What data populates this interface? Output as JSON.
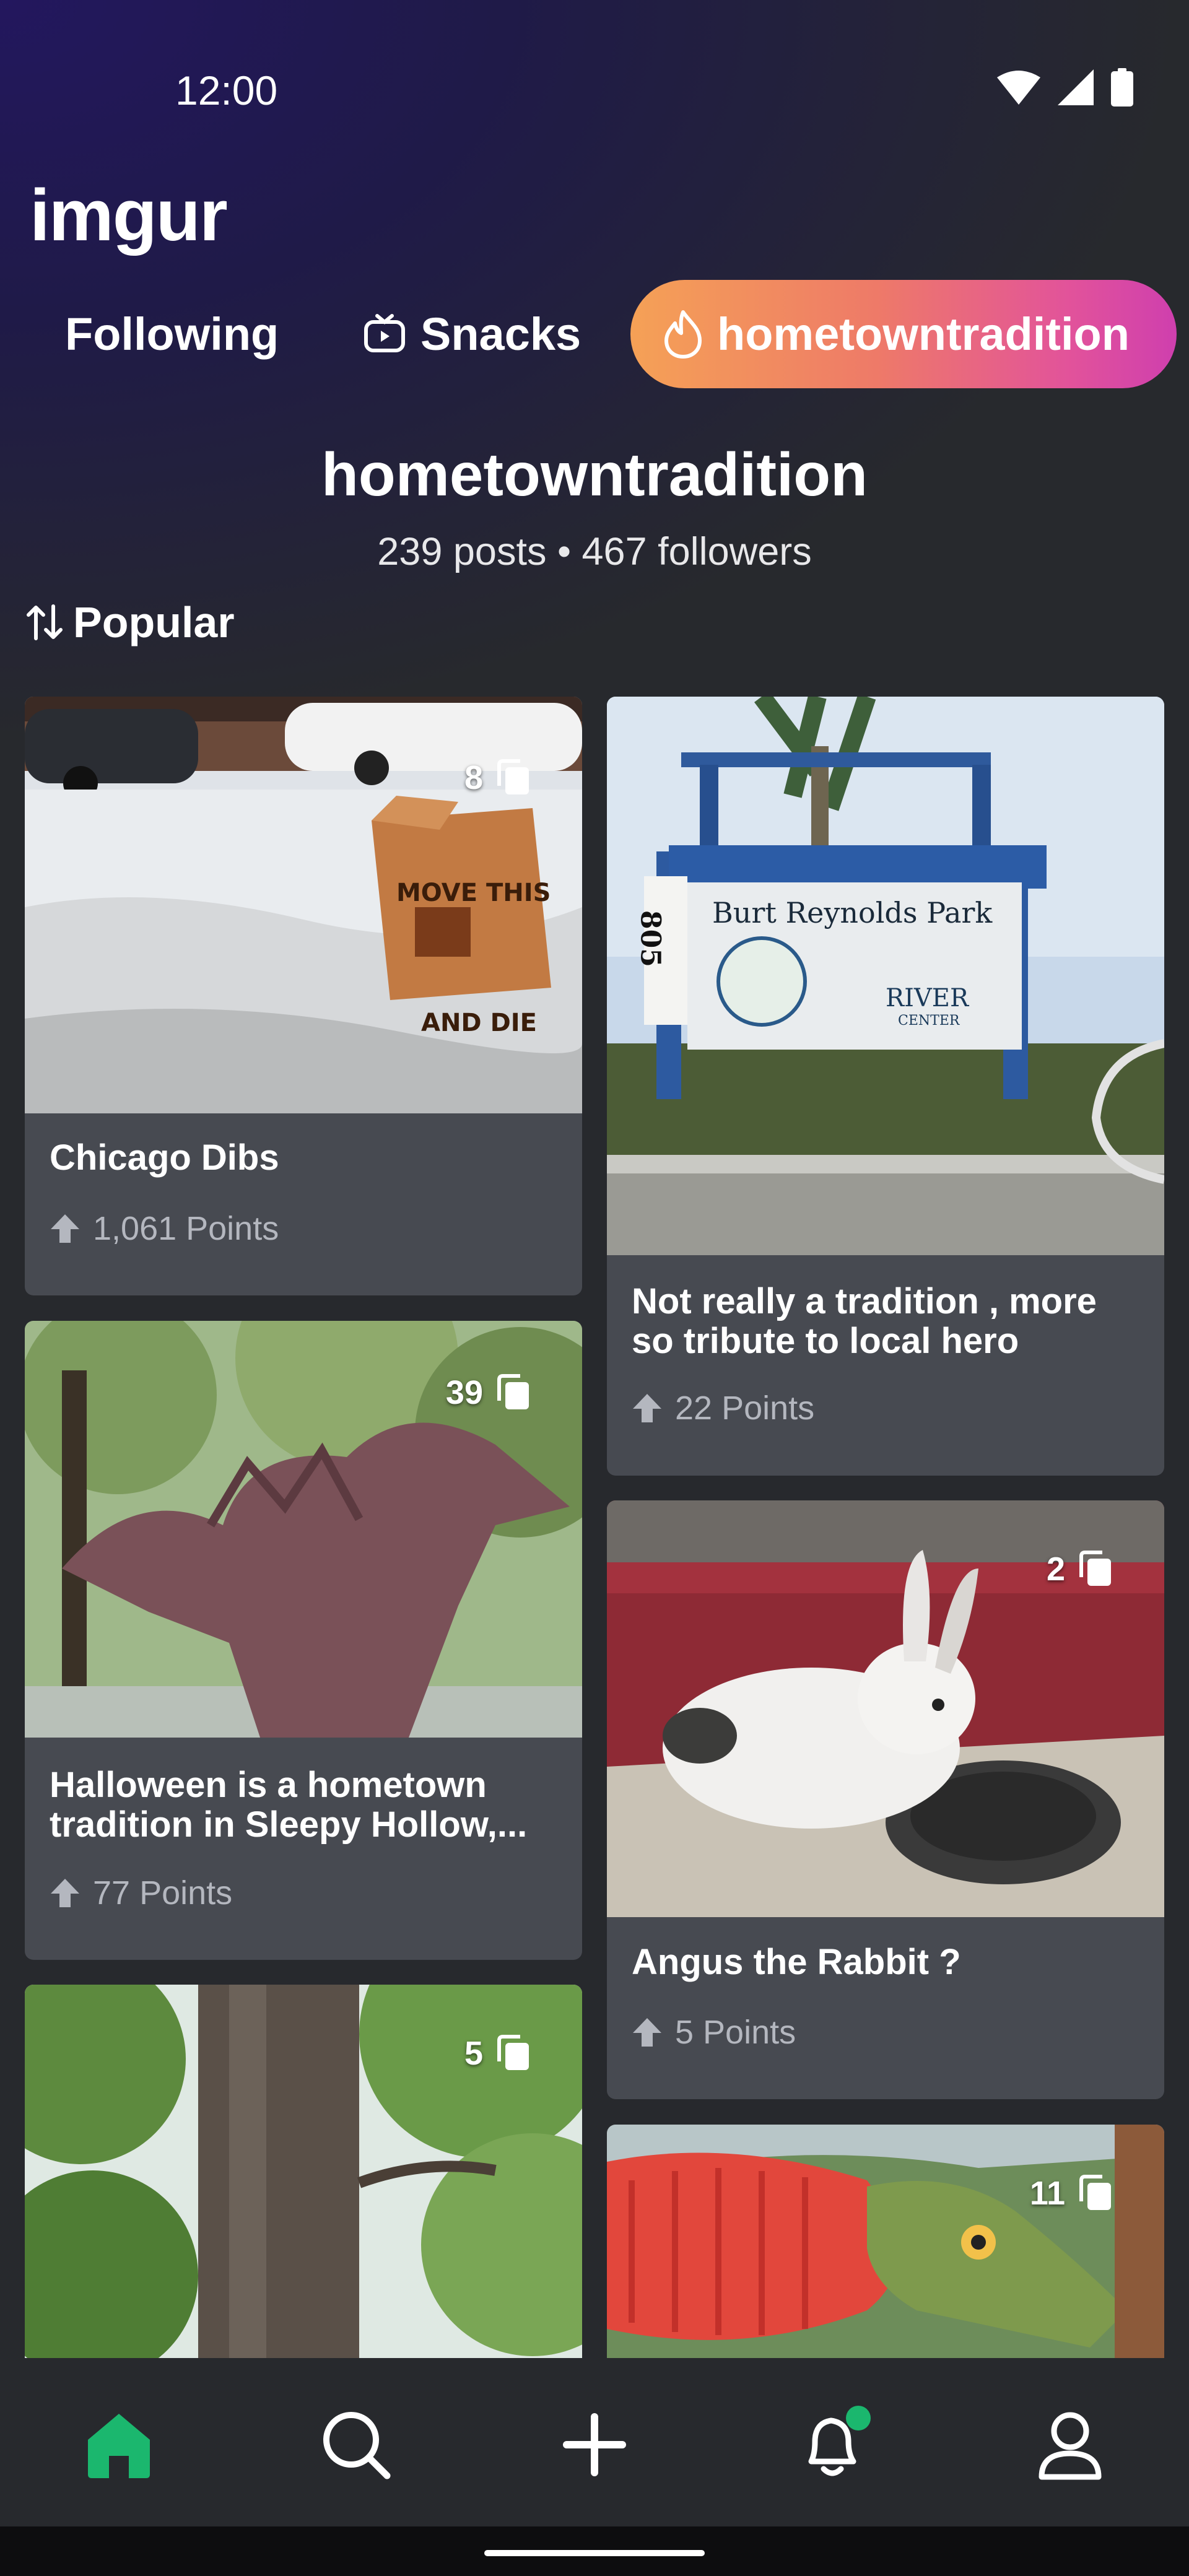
{
  "status_bar": {
    "time": "12:00"
  },
  "app": {
    "logo": "imgur"
  },
  "tabs": [
    {
      "label": "Following",
      "icon": ""
    },
    {
      "label": "Snacks",
      "icon": "snacks-tv-icon"
    },
    {
      "label": "hometowntradition",
      "icon": "flame-icon",
      "active": true
    }
  ],
  "tag": {
    "title": "hometowntradition",
    "stats": "239 posts • 467 followers"
  },
  "sort": {
    "label": "Popular"
  },
  "posts": [
    {
      "title": "Chicago Dibs",
      "points": "1,061 Points",
      "image_count": "8"
    },
    {
      "title": "Not really a tradition , more so tribute to local hero",
      "points": "22 Points",
      "image_count": ""
    },
    {
      "title": "Halloween is a hometown tradition in Sleepy Hollow,...",
      "points": "77 Points",
      "image_count": "39"
    },
    {
      "title": "Angus the Rabbit ?",
      "points": "5 Points",
      "image_count": "2"
    },
    {
      "title": "",
      "points": "",
      "image_count": "5"
    },
    {
      "title": "",
      "points": "",
      "image_count": "11"
    }
  ],
  "image_text": {
    "park_sign": "Burt Reynolds Park",
    "park_number": "805",
    "river_center": "RIVER",
    "center": "CENTER",
    "box_top": "MOVE THIS",
    "box_bottom": "AND DIE"
  },
  "bottom_nav": [
    {
      "name": "home",
      "icon": "home-icon",
      "active": true
    },
    {
      "name": "search",
      "icon": "search-icon"
    },
    {
      "name": "create",
      "icon": "plus-icon"
    },
    {
      "name": "notifications",
      "icon": "bell-icon",
      "badge": true
    },
    {
      "name": "profile",
      "icon": "user-icon"
    }
  ],
  "colors": {
    "accent_green": "#1bb76e",
    "card_bg": "#474a51",
    "page_bg": "#27292d",
    "tab_gradient_start": "#f5a156",
    "tab_gradient_end": "#cf3fae"
  }
}
